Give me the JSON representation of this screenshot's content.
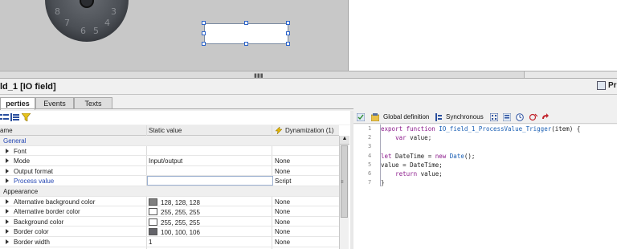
{
  "canvas": {
    "gauge_numbers": [
      "7",
      "6",
      "5",
      "4",
      "3",
      "8"
    ]
  },
  "title": "ld_1 [IO field]",
  "properties_tab": "Pr",
  "tabs": [
    "perties",
    "Events",
    "Texts"
  ],
  "grid": {
    "headers": {
      "name": "ame",
      "static": "Static value",
      "dyn": "Dynamization (1)"
    },
    "rows": [
      {
        "kind": "group",
        "name": "General",
        "static": "",
        "dyn": "",
        "color": ""
      },
      {
        "kind": "item",
        "name": "Font",
        "static": "",
        "dyn": "",
        "color": ""
      },
      {
        "kind": "item",
        "name": "Mode",
        "static": "Input/output",
        "dyn": "None",
        "color": ""
      },
      {
        "kind": "item",
        "name": "Output format",
        "static": "",
        "dyn": "None",
        "color": ""
      },
      {
        "kind": "item",
        "name": "Process value",
        "static": "",
        "dyn": "Script",
        "color": ""
      },
      {
        "kind": "group",
        "name": "Appearance",
        "static": "",
        "dyn": "",
        "color": ""
      },
      {
        "kind": "item",
        "name": "Alternative background color",
        "static": "128, 128, 128",
        "dyn": "None",
        "color": "#808080"
      },
      {
        "kind": "item",
        "name": "Alternative border color",
        "static": "255, 255, 255",
        "dyn": "None",
        "color": "#ffffff"
      },
      {
        "kind": "item",
        "name": "Background color",
        "static": "255, 255, 255",
        "dyn": "None",
        "color": "#ffffff"
      },
      {
        "kind": "item",
        "name": "Border color",
        "static": "100, 100, 106",
        "dyn": "None",
        "color": "#64646a"
      },
      {
        "kind": "item",
        "name": "Border width",
        "static": "1",
        "dyn": "None",
        "color": ""
      }
    ]
  },
  "script_toolbar": {
    "global_definition": "Global definition",
    "synchronous": "Synchronous"
  },
  "editor": {
    "lines": [
      {
        "n": "1",
        "html": "<span class=\"kw\">export function</span> <span class=\"sb\">IO_field_1_ProcessValue_Trigger</span>(item) {"
      },
      {
        "n": "2",
        "html": "    <span class=\"kw\">var</span> value;"
      },
      {
        "n": "3",
        "html": ""
      },
      {
        "n": "4",
        "html": "<span class=\"kw\">let</span> DateTime = <span class=\"kw\">new</span> <span class=\"sb\">Date</span>();"
      },
      {
        "n": "5",
        "html": "value = DateTime;"
      },
      {
        "n": "6",
        "html": "    <span class=\"kw\">return</span> value;"
      },
      {
        "n": "7",
        "html": "}"
      }
    ]
  },
  "colors": {
    "accent": "#2547b3",
    "selection": "#2b63c9"
  }
}
